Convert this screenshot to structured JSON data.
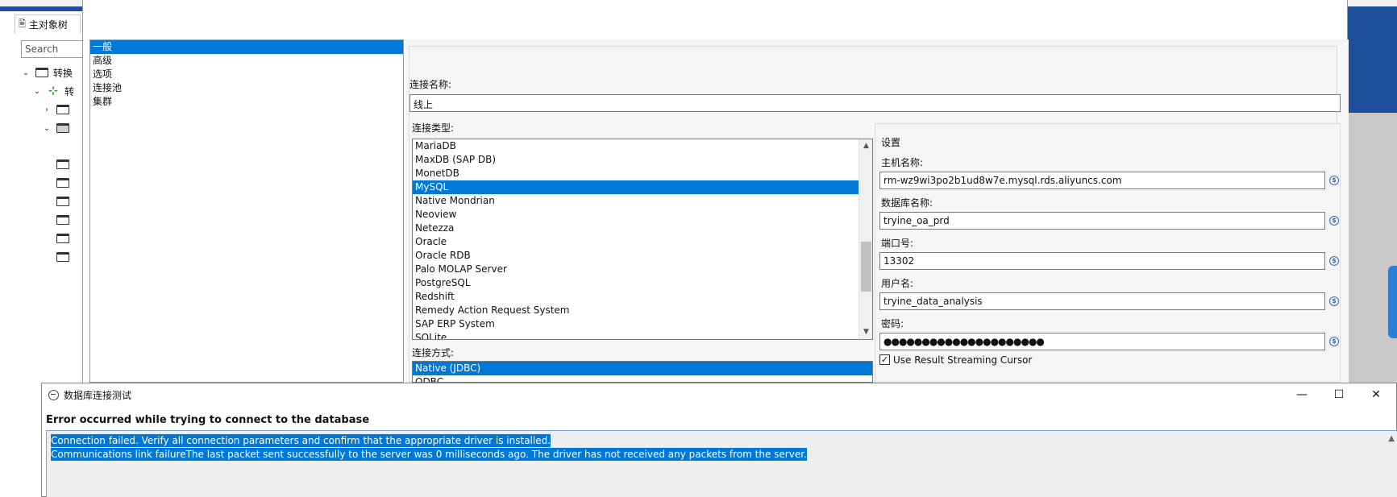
{
  "background": {
    "tree_tab_label": "主对象树",
    "search_placeholder": "Search",
    "tree_items": [
      {
        "label": "转换"
      },
      {
        "label": "转"
      }
    ]
  },
  "conn_dialog": {
    "categories": [
      {
        "label": "一般",
        "selected": true
      },
      {
        "label": "高级",
        "selected": false
      },
      {
        "label": "选项",
        "selected": false
      },
      {
        "label": "连接池",
        "selected": false
      },
      {
        "label": "集群",
        "selected": false
      }
    ],
    "connection_name_label": "连接名称:",
    "connection_name_value": "线上",
    "connection_type_label": "连接类型:",
    "connection_types": [
      {
        "label": "MariaDB",
        "selected": false
      },
      {
        "label": "MaxDB (SAP DB)",
        "selected": false
      },
      {
        "label": "MonetDB",
        "selected": false
      },
      {
        "label": "MySQL",
        "selected": true
      },
      {
        "label": "Native Mondrian",
        "selected": false
      },
      {
        "label": "Neoview",
        "selected": false
      },
      {
        "label": "Netezza",
        "selected": false
      },
      {
        "label": "Oracle",
        "selected": false
      },
      {
        "label": "Oracle RDB",
        "selected": false
      },
      {
        "label": "Palo MOLAP Server",
        "selected": false
      },
      {
        "label": "PostgreSQL",
        "selected": false
      },
      {
        "label": "Redshift",
        "selected": false
      },
      {
        "label": "Remedy Action Request System",
        "selected": false
      },
      {
        "label": "SAP ERP System",
        "selected": false
      },
      {
        "label": "SQLite",
        "selected": false
      }
    ],
    "access_label": "连接方式:",
    "access_types": [
      {
        "label": "Native (JDBC)",
        "selected": true
      },
      {
        "label": "ODBC",
        "selected": false
      }
    ],
    "settings": {
      "title": "设置",
      "host_label": "主机名称:",
      "host_value": "rm-wz9wi3po2b1ud8w7e.mysql.rds.aliyuncs.com",
      "db_label": "数据库名称:",
      "db_value": "tryine_oa_prd",
      "port_label": "端口号:",
      "port_value": "13302",
      "user_label": "用户名:",
      "user_value": "tryine_data_analysis",
      "password_label": "密码:",
      "password_value": "●●●●●●●●●●●●●●●●●●●●●",
      "streaming_label": "Use Result Streaming Cursor",
      "streaming_checked": true
    }
  },
  "error_dialog": {
    "title": "数据库连接测试",
    "heading": "Error occurred while trying to connect to the database",
    "line1": "Connection failed. Verify all connection parameters and confirm that the appropriate driver is installed.",
    "line2": "Communications link failureThe last packet sent successfully to the server was 0 milliseconds ago. The driver has not received any packets from the server.",
    "minimize_glyph": "—",
    "maximize_glyph": "☐",
    "close_glyph": "✕"
  },
  "colors": {
    "selection": "#0078d7",
    "brand_blue": "#1e4f9a"
  }
}
